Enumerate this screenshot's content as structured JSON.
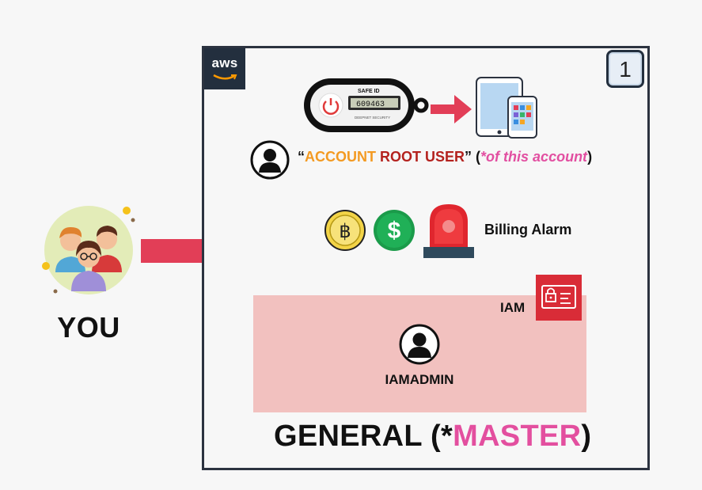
{
  "you": {
    "label": "YOU"
  },
  "account": {
    "logo_text": "aws",
    "badge_number": "1",
    "mfa_device": {
      "brand": "SAFE ID",
      "code": "609463",
      "caption": "DEEPNET SECURITY"
    },
    "root_user": {
      "open_quote": "“",
      "word1": "ACCOUNT",
      "word2": "ROOT USER",
      "close_quote": "”",
      "paren_open": "(",
      "note": "*of this account",
      "paren_close": ")"
    },
    "billing": {
      "coin1_symbol": "฿",
      "coin2_symbol": "$",
      "label": "Billing Alarm"
    },
    "iam": {
      "label": "IAM",
      "user_label": "IAMADMIN"
    },
    "title": {
      "prefix": "GENERAL (*",
      "highlight": "MASTER",
      "suffix": ")"
    }
  },
  "colors": {
    "arrow": "#e23e57",
    "iam_box": "#f2c1bf",
    "iam_icon": "#d92c37",
    "aws_dark": "#232f3e",
    "master_pink": "#e34f9f",
    "root_orange": "#f39a22",
    "root_darkred": "#b4221e"
  }
}
